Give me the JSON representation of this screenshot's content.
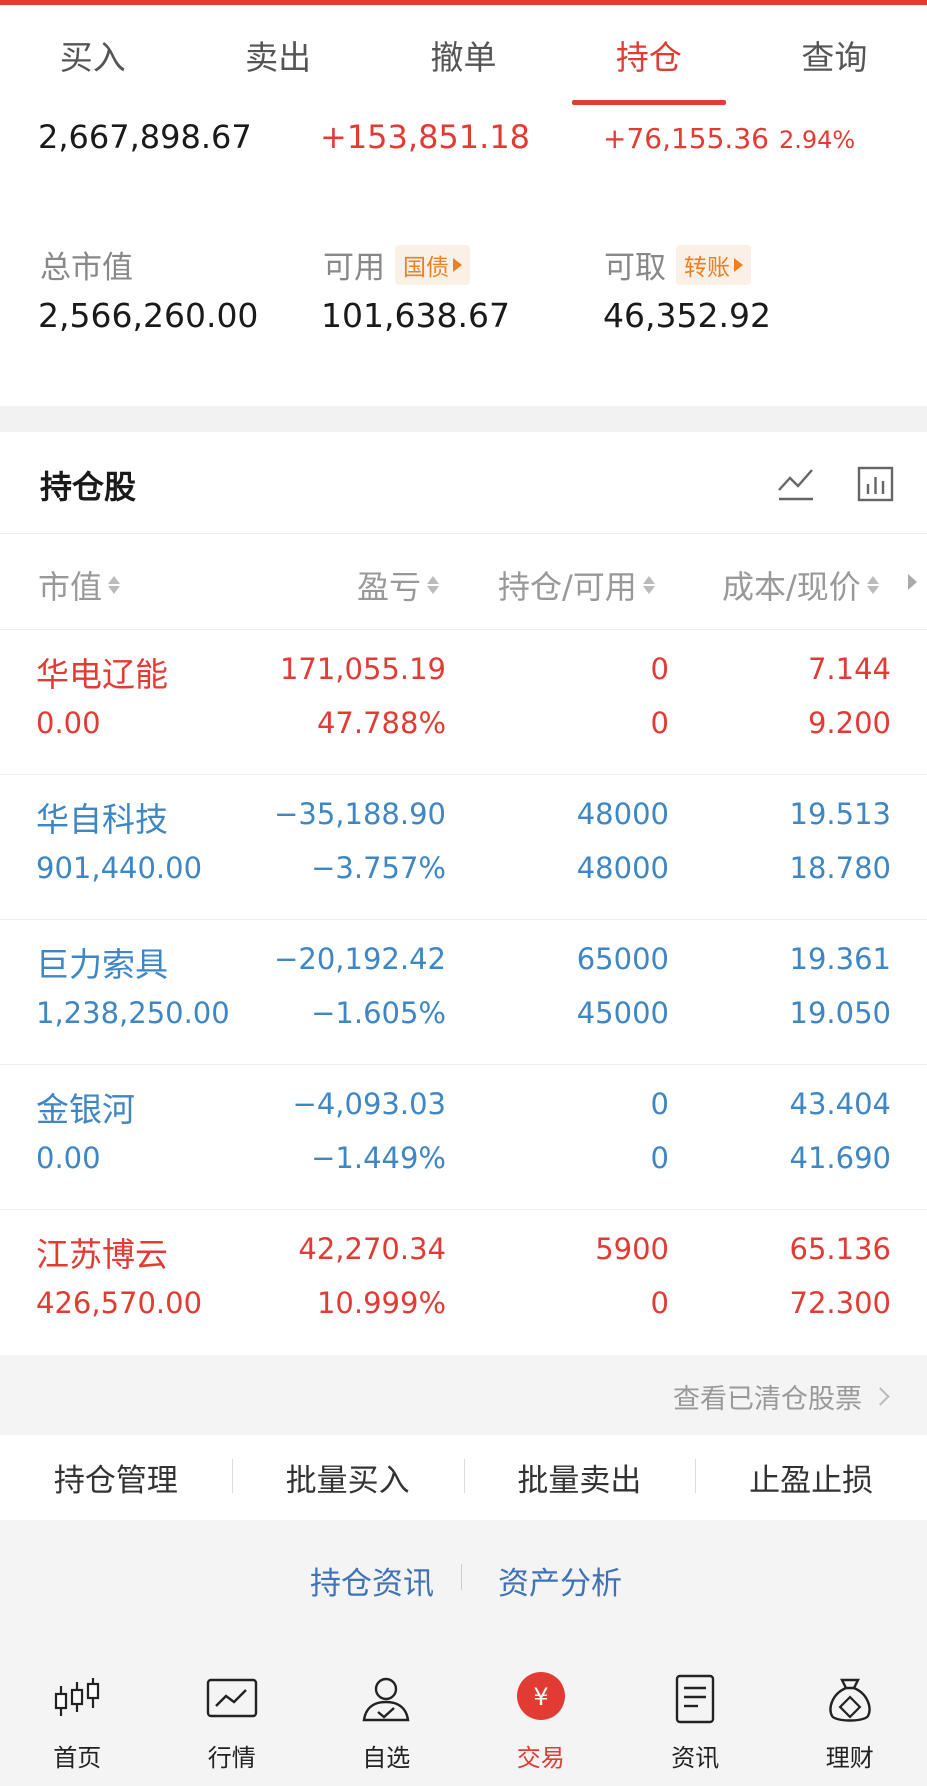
{
  "tabs": [
    "买入",
    "卖出",
    "撤单",
    "持仓",
    "查询"
  ],
  "summary": {
    "total_assets": "2,667,898.67",
    "floating_pl": "+153,851.18",
    "today_pl": "+76,155.36",
    "today_pl_pct": "2.94%",
    "market_value_label": "总市值",
    "market_value": "2,566,260.00",
    "available_label": "可用",
    "available_pill": "国债",
    "available": "101,638.67",
    "withdrawable_label": "可取",
    "withdrawable_pill": "转账",
    "withdrawable": "46,352.92"
  },
  "holdings": {
    "title": "持仓股",
    "columns": [
      "市值",
      "盈亏",
      "持仓/可用",
      "成本/现价"
    ],
    "rows": [
      {
        "name": "华电辽能",
        "market_value": "0.00",
        "pl": "171,055.19",
        "pl_pct": "47.788%",
        "position": "0",
        "available": "0",
        "cost": "7.144",
        "price": "9.200",
        "color": "#e23b33"
      },
      {
        "name": "华自科技",
        "market_value": "901,440.00",
        "pl": "−35,188.90",
        "pl_pct": "−3.757%",
        "position": "48000",
        "available": "48000",
        "cost": "19.513",
        "price": "18.780",
        "color": "#3f86c4"
      },
      {
        "name": "巨力索具",
        "market_value": "1,238,250.00",
        "pl": "−20,192.42",
        "pl_pct": "−1.605%",
        "position": "65000",
        "available": "45000",
        "cost": "19.361",
        "price": "19.050",
        "color": "#3f86c4"
      },
      {
        "name": "金银河",
        "market_value": "0.00",
        "pl": "−4,093.03",
        "pl_pct": "−1.449%",
        "position": "0",
        "available": "0",
        "cost": "43.404",
        "price": "41.690",
        "color": "#3f86c4"
      },
      {
        "name": "江苏博云",
        "market_value": "426,570.00",
        "pl": "42,270.34",
        "pl_pct": "10.999%",
        "position": "5900",
        "available": "0",
        "cost": "65.136",
        "price": "72.300",
        "color": "#e23b33"
      }
    ]
  },
  "cleared_link": "查看已清仓股票",
  "actions": [
    "持仓管理",
    "批量买入",
    "批量卖出",
    "止盈止损"
  ],
  "info_links": [
    "持仓资讯",
    "资产分析"
  ],
  "bottom_nav": [
    {
      "label": "首页",
      "icon": "candlestick-icon"
    },
    {
      "label": "行情",
      "icon": "chart-icon"
    },
    {
      "label": "自选",
      "icon": "user-check-icon"
    },
    {
      "label": "交易",
      "icon": "yen-icon"
    },
    {
      "label": "资讯",
      "icon": "document-icon"
    },
    {
      "label": "理财",
      "icon": "money-bag-icon"
    }
  ],
  "colors": {
    "accent": "#e23b33",
    "loss": "#3f86c4",
    "pill": "#ef7f1f"
  }
}
